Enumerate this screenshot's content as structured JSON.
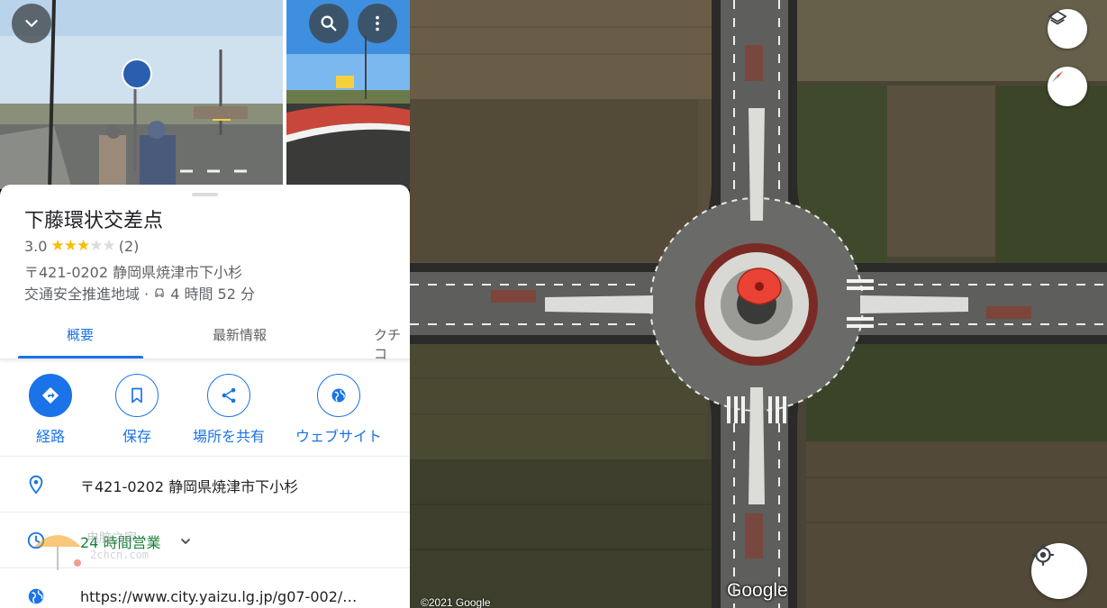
{
  "place": {
    "title": "下藤環状交差点",
    "rating": "3.0",
    "review_count": "(2)",
    "stars_filled": 3,
    "stars_total": 5,
    "address_short": "〒421-0202 静岡県焼津市下小杉",
    "category": "交通安全推進地域 ·",
    "drive_time": "4 時間 52 分"
  },
  "tabs": [
    {
      "label": "概要",
      "active": true
    },
    {
      "label": "最新情報",
      "active": false
    },
    {
      "label": "クチコ",
      "active": false
    }
  ],
  "actions": [
    {
      "label": "経路",
      "icon": "directions-icon"
    },
    {
      "label": "保存",
      "icon": "bookmark-icon"
    },
    {
      "label": "場所を共有",
      "icon": "share-icon"
    },
    {
      "label": "ウェブサイト",
      "icon": "globe-icon"
    }
  ],
  "info": {
    "address": "〒421-0202 静岡県焼津市下小杉",
    "hours": "24 時間営業",
    "website": "https://www.city.yaizu.lg.jp/g07-002/…"
  },
  "map": {
    "logo": "Google",
    "copyright": "©2021 Google"
  },
  "watermark": {
    "line1": "电脑之家",
    "line2": "2chcn.com"
  },
  "colors": {
    "accent": "#1a73e8",
    "open_green": "#188038",
    "pin_red": "#ea4335",
    "star": "#fbbc04"
  }
}
